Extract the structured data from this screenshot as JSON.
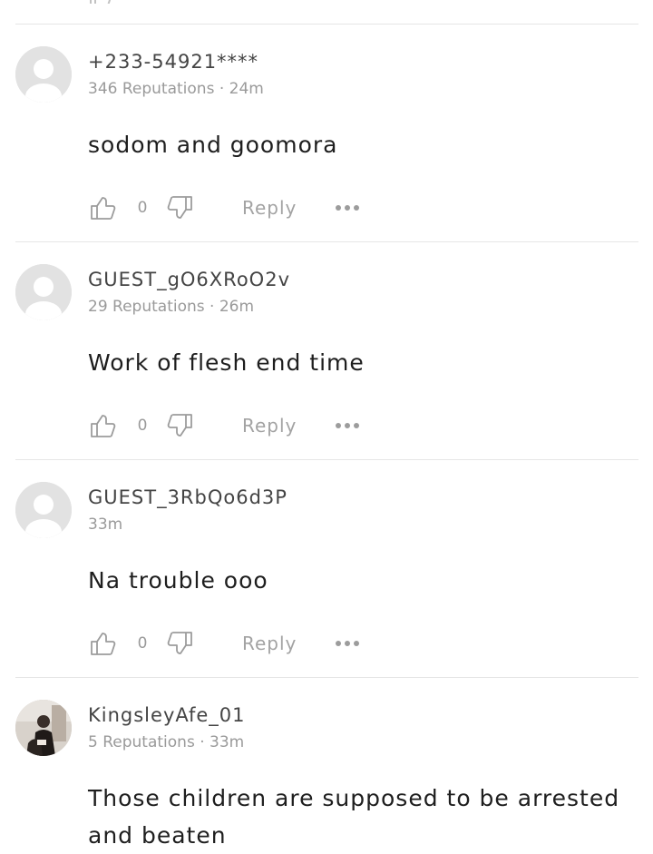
{
  "colors": {
    "text_primary": "#1e1e1e",
    "text_secondary": "#9a9a9a",
    "icon": "#9c9c9c",
    "divider": "#e6e6e6",
    "avatar_placeholder": "#e2e2e2"
  },
  "comments": [
    {
      "author": "+233-54921****",
      "meta": "346 Reputations · 24m",
      "text": "sodom and goomora",
      "likes": "0",
      "reply_label": "Reply",
      "avatar": "default-avatar-icon"
    },
    {
      "author": "GUEST_gO6XRoO2v",
      "meta": "29 Reputations · 26m",
      "text": "Work of flesh end time",
      "likes": "0",
      "reply_label": "Reply",
      "avatar": "default-avatar-icon"
    },
    {
      "author": "GUEST_3RbQo6d3P",
      "meta": "33m",
      "text": "Na trouble ooo",
      "likes": "0",
      "reply_label": "Reply",
      "avatar": "default-avatar-icon"
    },
    {
      "author": "KingsleyAfe_01",
      "meta": "5 Reputations · 33m",
      "text": "Those children are supposed to be arrested and beaten",
      "avatar": "user-photo"
    }
  ]
}
